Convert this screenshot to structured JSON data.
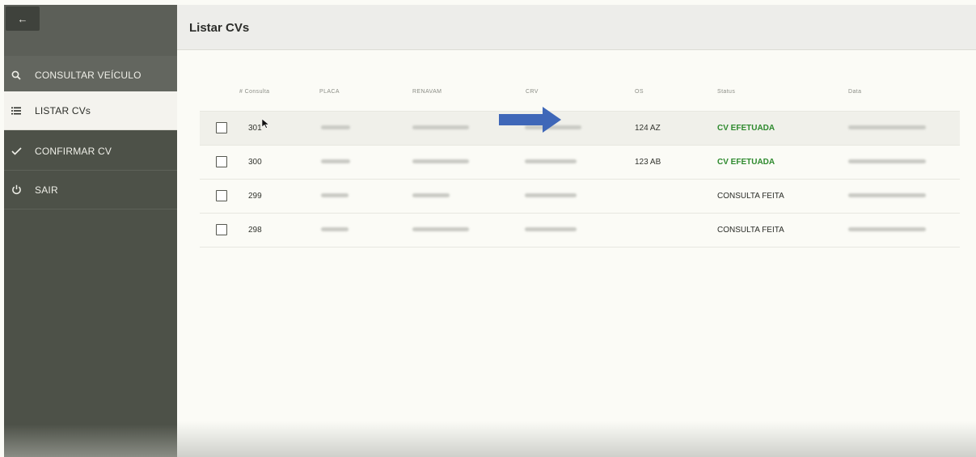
{
  "app": {
    "title": "Listar CVs",
    "back_icon": "arrow-left-icon"
  },
  "sidebar": {
    "items": [
      {
        "label": "CONSULTAR VEÍCULO",
        "icon": "search-icon"
      },
      {
        "label": "LISTAR CVs",
        "icon": "list-icon"
      },
      {
        "label": "CONFIRMAR CV",
        "icon": "check-icon"
      },
      {
        "label": "SAIR",
        "icon": "power-icon"
      }
    ]
  },
  "table": {
    "columns": [
      "# Consulta",
      "PLACA",
      "RENAVAM",
      "CRV",
      "OS",
      "Status",
      "Data"
    ],
    "rows": [
      {
        "consulta": "301",
        "os": "124 AZ",
        "status": "CV EFETUADA"
      },
      {
        "consulta": "300",
        "os": "123 AB",
        "status": "CV EFETUADA"
      },
      {
        "consulta": "299",
        "os": "",
        "status": "CONSULTA FEITA"
      },
      {
        "consulta": "298",
        "os": "",
        "status": "CONSULTA FEITA"
      }
    ]
  },
  "colors": {
    "sidebar_bg": "#4d5148",
    "status_done": "#2e8a2e",
    "annotation_arrow": "#3f67b8"
  }
}
